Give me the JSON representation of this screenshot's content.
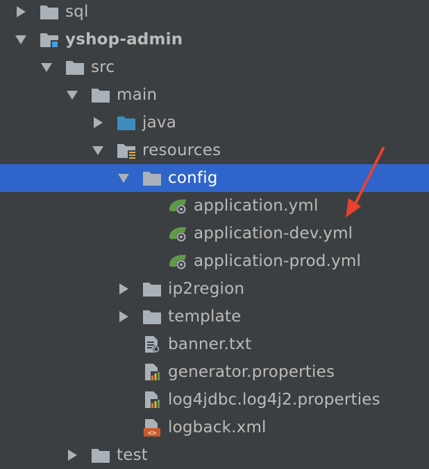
{
  "tree": {
    "items": [
      {
        "label": "sql",
        "icon": "folder-icon",
        "expanded": false,
        "indent": 0
      },
      {
        "label": "yshop-admin",
        "icon": "module-folder-icon",
        "expanded": true,
        "indent": 0
      },
      {
        "label": "src",
        "icon": "folder-icon",
        "expanded": true,
        "indent": 1
      },
      {
        "label": "main",
        "icon": "folder-icon",
        "expanded": true,
        "indent": 2
      },
      {
        "label": "java",
        "icon": "source-folder-icon",
        "expanded": false,
        "indent": 3
      },
      {
        "label": "resources",
        "icon": "resources-folder-icon",
        "expanded": true,
        "indent": 3
      },
      {
        "label": "config",
        "icon": "folder-icon",
        "expanded": true,
        "indent": 4,
        "selected": true
      },
      {
        "label": "application.yml",
        "icon": "spring-config-icon",
        "indent": 5
      },
      {
        "label": "application-dev.yml",
        "icon": "spring-config-icon",
        "indent": 5
      },
      {
        "label": "application-prod.yml",
        "icon": "spring-config-icon",
        "indent": 5
      },
      {
        "label": "ip2region",
        "icon": "folder-icon",
        "expanded": false,
        "indent": 4
      },
      {
        "label": "template",
        "icon": "folder-icon",
        "expanded": false,
        "indent": 4
      },
      {
        "label": "banner.txt",
        "icon": "text-file-icon",
        "indent": 4
      },
      {
        "label": "generator.properties",
        "icon": "properties-file-icon",
        "indent": 4
      },
      {
        "label": "log4jdbc.log4j2.properties",
        "icon": "properties-file-icon",
        "indent": 4
      },
      {
        "label": "logback.xml",
        "icon": "xml-file-icon",
        "indent": 4
      },
      {
        "label": "test",
        "icon": "folder-icon",
        "expanded": false,
        "indent": 2
      }
    ]
  },
  "colors": {
    "background": "#3c3f41",
    "selection": "#2f65ca",
    "text": "#bbbbbb",
    "folder": "#a9b2b9",
    "source_folder": "#3c8dbd",
    "annotation_arrow": "#e8432e"
  }
}
